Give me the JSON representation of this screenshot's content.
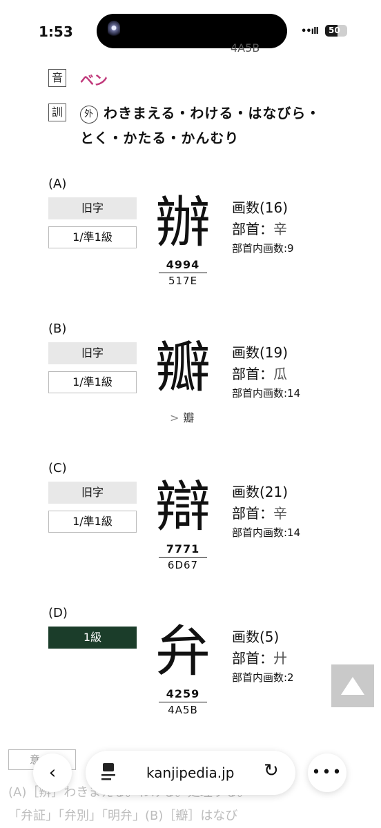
{
  "status_bar": {
    "time": "1:53",
    "battery": "50"
  },
  "top_code": "4A5B",
  "readings": {
    "on_label": "音",
    "on_value": "ベン",
    "kun_label": "訓",
    "kun_gai": "外",
    "kun_value": "わきまえる・わける・はなびら・とく・かたる・かんむり"
  },
  "variants": [
    {
      "label": "(A)",
      "tag": "旧字",
      "level": "1/準1級",
      "kanji": "辦",
      "code1": "4994",
      "code2": "517E",
      "strokes": "画数(16)",
      "radical_label": "部首：",
      "radical": "辛",
      "inner": "部首内画数:9"
    },
    {
      "label": "(B)",
      "tag": "旧字",
      "level": "1/準1級",
      "kanji": "瓣",
      "sub": "瓣",
      "strokes": "画数(19)",
      "radical_label": "部首：",
      "radical": "瓜",
      "inner": "部首内画数:14"
    },
    {
      "label": "(C)",
      "tag": "旧字",
      "level": "1/準1級",
      "kanji": "辯",
      "code1": "7771",
      "code2": "6D67",
      "strokes": "画数(21)",
      "radical_label": "部首：",
      "radical": "辛",
      "inner": "部首内画数:14"
    },
    {
      "label": "(D)",
      "level": "1級",
      "kanji": "弁",
      "code1": "4259",
      "code2": "4A5B",
      "strokes": "画数(5)",
      "radical_label": "部首：",
      "radical": "廾",
      "inner": "部首内画数:2"
    }
  ],
  "meaning": {
    "badge": "意",
    "line1": "(A)［辨］わきまえる。わける。処理する。",
    "line2": "「弁証」「弁別」「明弁」(B)［瓣］はなび"
  },
  "browser": {
    "url": "kanjipedia.jp"
  },
  "icons": {
    "back": "chevron-left-icon",
    "tabs": "tabs-icon",
    "reload": "reload-icon",
    "more": "more-icon",
    "scroll_top": "triangle-up-icon"
  }
}
